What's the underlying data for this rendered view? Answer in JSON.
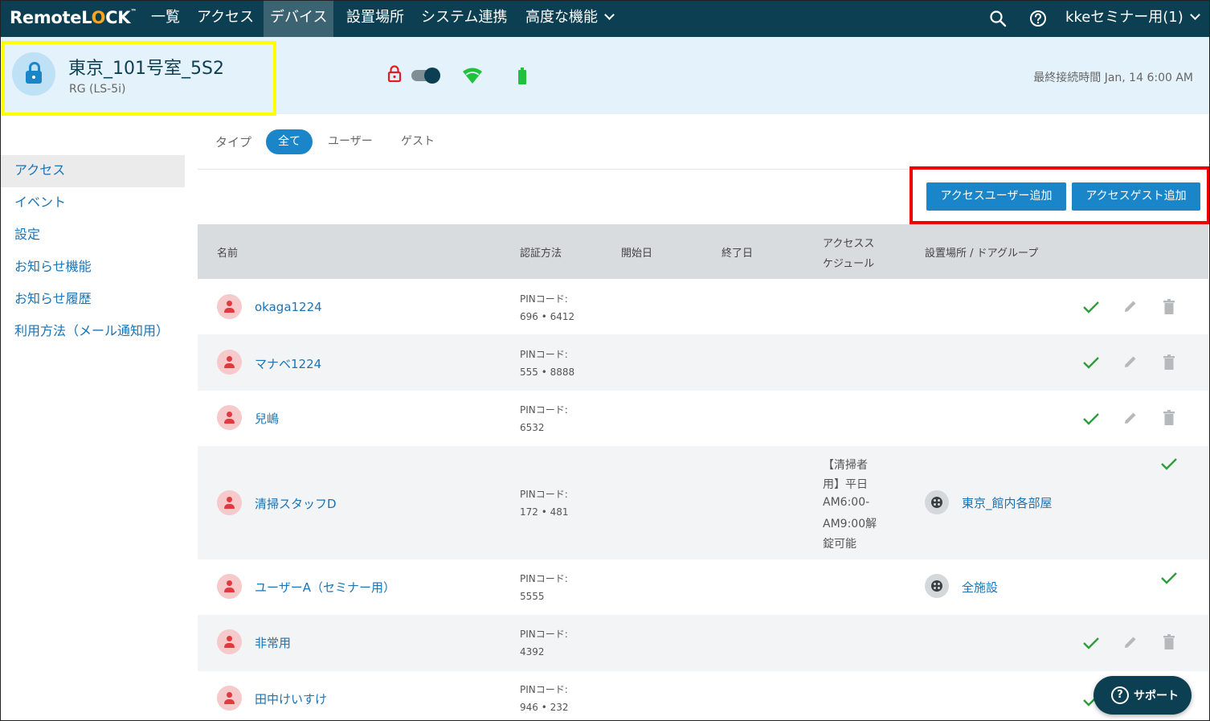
{
  "app": {
    "logo": {
      "part1": "Remote",
      "lock_l": "L",
      "lock_o": "O",
      "part2": "CK",
      "tm": "™"
    },
    "nav": [
      {
        "label": "一覧"
      },
      {
        "label": "アクセス"
      },
      {
        "label": "デバイス",
        "active": true
      },
      {
        "label": "設置場所"
      },
      {
        "label": "システム連携"
      },
      {
        "label": "高度な機能"
      }
    ],
    "account_label": "kkeセミナー用(1)",
    "icons": {
      "search": "search-icon",
      "help": "help-circle-icon",
      "dropdown": "chevron-down-icon"
    }
  },
  "device": {
    "name": "東京_101号室_5S2",
    "model": "RG (LS-5i)",
    "status": {
      "locked": true,
      "toggle_on": true,
      "wifi": "connected",
      "battery": "full"
    },
    "last_connected": "最終接続時間 Jan, 14 6:00 AM",
    "colors": {
      "lock_status": "#e02020",
      "wifi": "#1fc23a",
      "battery": "#1fc23a",
      "accent": "#1a86c9"
    }
  },
  "sidebar": {
    "items": [
      {
        "label": "アクセス",
        "active": true
      },
      {
        "label": "イベント"
      },
      {
        "label": "設定"
      },
      {
        "label": "お知らせ機能"
      },
      {
        "label": "お知らせ履歴"
      },
      {
        "label": "利用方法（メール通知用）"
      }
    ]
  },
  "filter": {
    "label": "タイプ",
    "options": [
      {
        "label": "全て",
        "active": true
      },
      {
        "label": "ユーザー"
      },
      {
        "label": "ゲスト"
      }
    ]
  },
  "buttons": {
    "add_user": "アクセスユーザー追加",
    "add_guest": "アクセスゲスト追加"
  },
  "table": {
    "headers": {
      "name": "名前",
      "auth": "認証方法",
      "start": "開始日",
      "end": "終了日",
      "schedule_1": "アクセスス",
      "schedule_2": "ケジュール",
      "location": "設置場所 / ドアグループ"
    },
    "rows": [
      {
        "name": "okaga1224",
        "pin_label": "PINコード:",
        "pin": "696 • 6412",
        "schedule": [],
        "location": "",
        "actions": [
          "check",
          "edit",
          "delete"
        ]
      },
      {
        "name": "マナベ1224",
        "pin_label": "PINコード:",
        "pin": "555 • 8888",
        "schedule": [],
        "location": "",
        "actions": [
          "check",
          "edit",
          "delete"
        ]
      },
      {
        "name": "兒嶋",
        "pin_label": "PINコード:",
        "pin": "6532",
        "schedule": [],
        "location": "",
        "actions": [
          "check",
          "edit",
          "delete"
        ]
      },
      {
        "name": "清掃スタッフD",
        "pin_label": "PINコード:",
        "pin": "172 • 481",
        "schedule": [
          "【清掃者",
          "用】平日",
          "AM6:00-",
          "AM9:00解",
          "錠可能"
        ],
        "location": "東京_館内各部屋",
        "actions": [
          "check"
        ]
      },
      {
        "name": "ユーザーA（セミナー用）",
        "pin_label": "PINコード:",
        "pin": "5555",
        "schedule": [],
        "location": "全施設",
        "actions": [
          "check"
        ]
      },
      {
        "name": "非常用",
        "pin_label": "PINコード:",
        "pin": "4392",
        "schedule": [],
        "location": "",
        "actions": [
          "check",
          "edit",
          "delete"
        ]
      },
      {
        "name": "田中けいすけ",
        "pin_label": "PINコード:",
        "pin": "946 • 232",
        "schedule": [],
        "location": "",
        "actions": [
          "check"
        ]
      }
    ]
  },
  "support": {
    "label": "サポート"
  }
}
